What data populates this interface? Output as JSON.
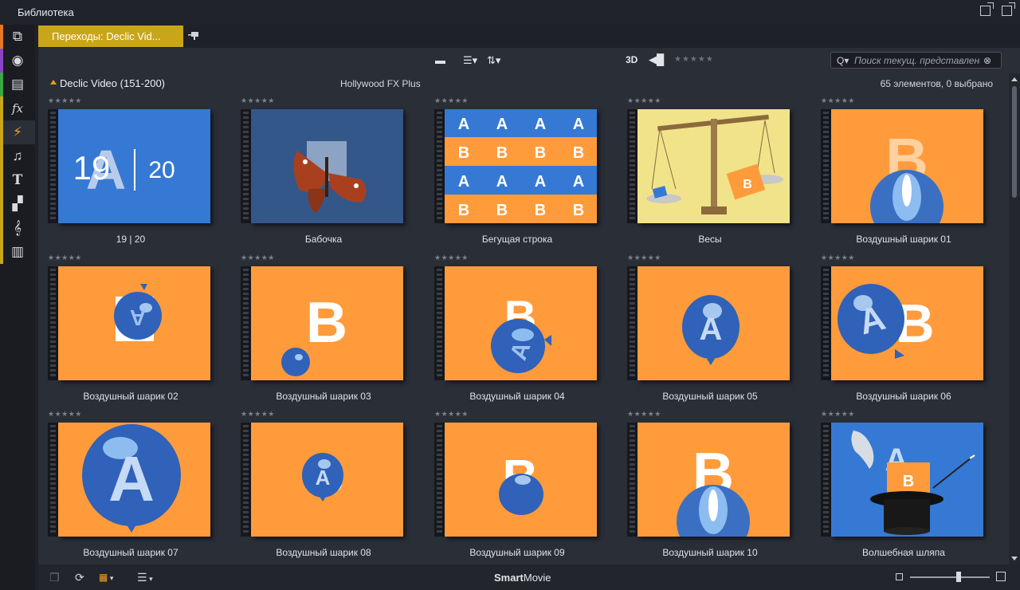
{
  "window": {
    "title": "Библиотека"
  },
  "tab": {
    "label": "Переходы: Declic Vid..."
  },
  "toolbar": {
    "mode_3d": "3D",
    "search_placeholder": "Поиск текущ. представления"
  },
  "section": {
    "name": "Declic Video (151-200)",
    "subtitle": "Hollywood FX Plus",
    "count": "65 элементов, 0 выбрано"
  },
  "items": [
    {
      "label": "19 | 20"
    },
    {
      "label": "Бабочка"
    },
    {
      "label": "Бегущая строка"
    },
    {
      "label": "Весы"
    },
    {
      "label": "Воздушный шарик 01"
    },
    {
      "label": "Воздушный шарик 02"
    },
    {
      "label": "Воздушный шарик 03"
    },
    {
      "label": "Воздушный шарик 04"
    },
    {
      "label": "Воздушный шарик 05"
    },
    {
      "label": "Воздушный шарик 06"
    },
    {
      "label": "Воздушный шарик 07"
    },
    {
      "label": "Воздушный шарик 08"
    },
    {
      "label": "Воздушный шарик 09"
    },
    {
      "label": "Воздушный шарик 10"
    },
    {
      "label": "Волшебная шляпа"
    }
  ],
  "thumb_text": {
    "n19": "19",
    "a": "A",
    "n20": "20",
    "b": "B"
  },
  "statusbar": {
    "smart_bold": "Smart",
    "smart_rest": "Movie"
  },
  "icons": {
    "sidebar": [
      "box-icon",
      "film-reel-icon",
      "stack-icon",
      "fx-icon",
      "transition-icon",
      "music-icon",
      "title-icon",
      "montage-icon",
      "clef-icon",
      "piano-icon"
    ],
    "sidebar_stripes": [
      "#e87722",
      "#8a44c8",
      "#3aa843",
      "#c9a51a",
      "#c9a51a",
      "#c9a51a",
      "#c9a51a",
      "#c9a51a",
      "#c9a51a",
      "#c9a51a"
    ]
  },
  "colors": {
    "accent_tab": "#c9a51a",
    "thumb_blue": "#3579d4",
    "thumb_orange": "#ff9b3b"
  }
}
